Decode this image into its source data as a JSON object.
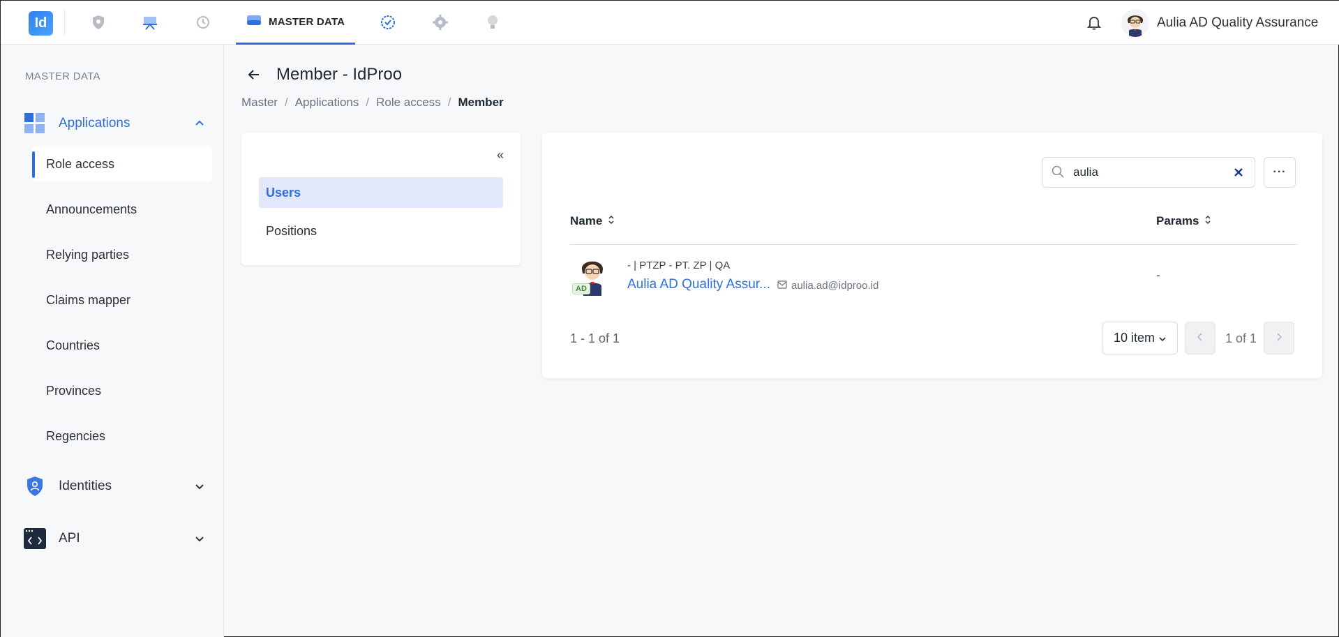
{
  "topbar": {
    "logo_text": "Id",
    "active_tab_label": "MASTER DATA",
    "user_name": "Aulia AD Quality Assurance",
    "icons": [
      "shield-icon",
      "presentation-icon",
      "history-icon",
      "database-icon",
      "badge-check-icon",
      "gear-icon",
      "lightbulb-icon",
      "bell-icon"
    ]
  },
  "sidebar": {
    "section_title": "MASTER DATA",
    "groups": [
      {
        "label": "Applications",
        "icon": "apps-grid-icon",
        "expanded": true
      },
      {
        "label": "Identities",
        "icon": "shield-user-icon",
        "expanded": false
      },
      {
        "label": "API",
        "icon": "code-window-icon",
        "expanded": false
      }
    ],
    "items": [
      {
        "label": "Role access",
        "active": true
      },
      {
        "label": "Announcements"
      },
      {
        "label": "Relying parties"
      },
      {
        "label": "Claims mapper"
      },
      {
        "label": "Countries"
      },
      {
        "label": "Provinces"
      },
      {
        "label": "Regencies"
      }
    ]
  },
  "page": {
    "title": "Member - IdProo",
    "breadcrumb": [
      "Master",
      "Applications",
      "Role access",
      "Member"
    ]
  },
  "left_menu": {
    "collapse_glyph": "«",
    "items": [
      {
        "label": "Users",
        "active": true
      },
      {
        "label": "Positions"
      }
    ]
  },
  "table": {
    "search_value": "aulia",
    "more_glyph": "···",
    "columns": [
      "Name",
      "Params"
    ],
    "rows": [
      {
        "badge": "AD",
        "meta": "- | PTZP - PT. ZP | QA",
        "name": "Aulia AD Quality Assur...",
        "email": "aulia.ad@idproo.id",
        "params": "-"
      }
    ],
    "range_text": "1 - 1 of 1",
    "per_page": "10 item",
    "page_text": "1 of 1"
  },
  "colors": {
    "accent": "#2f6fdc",
    "active_menu_bg": "#e2e7fb",
    "badge_green": "#3c8a3e"
  }
}
